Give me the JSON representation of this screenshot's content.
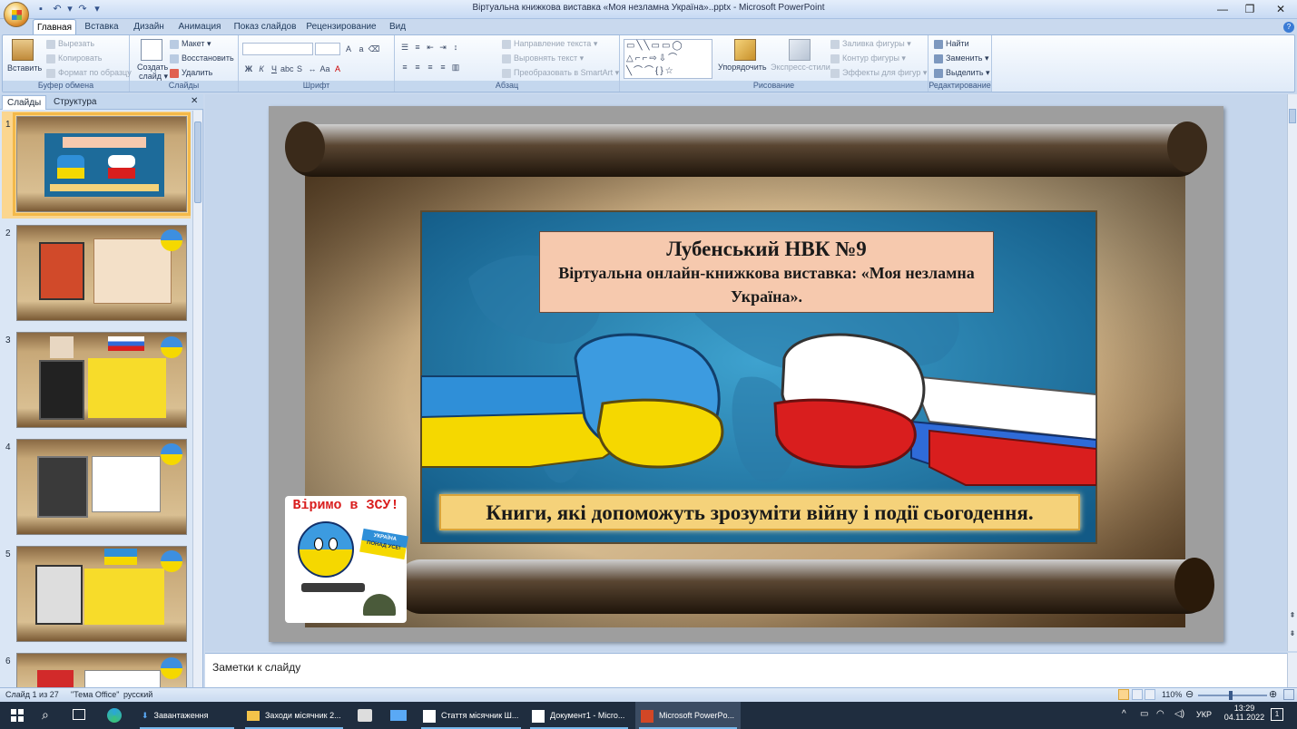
{
  "window": {
    "title": "Віртуальна книжкова виставка «Моя незламна Україна»..pptx - Microsoft PowerPoint"
  },
  "ribbon_tabs": [
    "Главная",
    "Вставка",
    "Дизайн",
    "Анимация",
    "Показ слайдов",
    "Рецензирование",
    "Вид"
  ],
  "clipboard": {
    "paste": "Вставить",
    "cut": "Вырезать",
    "copy": "Копировать",
    "format_painter": "Формат по образцу",
    "label": "Буфер обмена"
  },
  "slides_group": {
    "new_slide_1": "Создать",
    "new_slide_2": "слайд ▾",
    "layout": "Макет ▾",
    "reset": "Восстановить",
    "delete": "Удалить",
    "label": "Слайды"
  },
  "font_group": {
    "label": "Шрифт"
  },
  "paragraph_group": {
    "text_direction": "Направление текста ▾",
    "align_text": "Выровнять текст ▾",
    "smartart": "Преобразовать в SmartArt ▾",
    "label": "Абзац"
  },
  "drawing_group": {
    "arrange": "Упорядочить",
    "quick_styles": "Экспресс-стили",
    "shape_fill": "Заливка фигуры ▾",
    "shape_outline": "Контур фигуры ▾",
    "shape_effects": "Эффекты для фигур ▾",
    "label": "Рисование"
  },
  "editing_group": {
    "find": "Найти",
    "replace": "Заменить ▾",
    "select": "Выделить ▾",
    "label": "Редактирование"
  },
  "pane_tabs": {
    "slides": "Слайды",
    "outline": "Структура"
  },
  "slide_numbers": [
    "1",
    "2",
    "3",
    "4",
    "5",
    "6"
  ],
  "slide": {
    "title_line1": "Лубенський НВК №9",
    "title_line2": "Віртуальна онлайн-книжкова виставка: «Моя незламна Україна».",
    "caption": "Книги, які допоможуть зрозуміти війну і події сьогодення.",
    "badge_top": "Віримо в ЗСУ!",
    "flag_text_1": "УКРАЇНА",
    "flag_text_2": "ПОНАД УСЕ!"
  },
  "notes_placeholder": "Заметки к слайду",
  "status": {
    "slide_count": "Слайд 1 из 27",
    "theme": "\"Тема Office\"",
    "language": "русский",
    "zoom": "110%"
  },
  "taskbar": {
    "items": [
      "Завантаження",
      "Заходи місячник 2...",
      "Стаття місячник Ш...",
      "Документ1 - Micro...",
      "Microsoft PowerPo..."
    ],
    "lang": "УКР",
    "time": "13:29",
    "date": "04.11.2022",
    "notif": "1"
  },
  "colors": {
    "ribbon_bg": "#dfeaf8",
    "title_box": "#f6c9ae",
    "caption_box": "#f5d27a",
    "ukraine_blue": "#2f8fd8",
    "ukraine_yellow": "#f5d800",
    "russia_red": "#d91e1e",
    "taskbar": "#1f2d3f"
  }
}
